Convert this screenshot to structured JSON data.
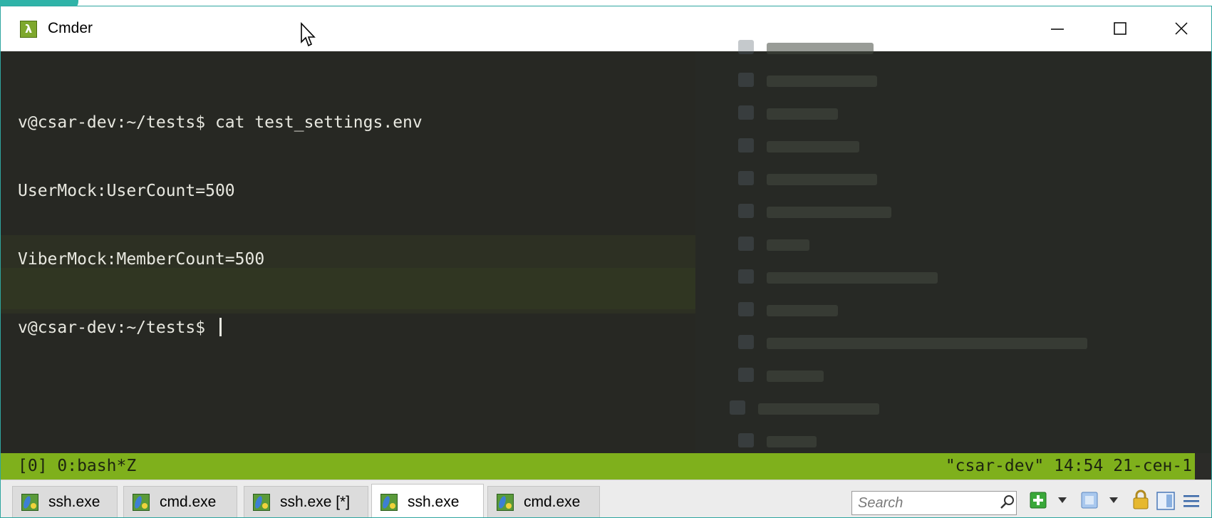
{
  "window": {
    "title": "Cmder",
    "app_icon_glyph": "λ",
    "controls": {
      "minimize_icon": "minimize-icon",
      "maximize_icon": "maximize-icon",
      "close_icon": "close-icon"
    }
  },
  "terminal": {
    "lines": [
      "v@csar-dev:~/tests$ cat test_settings.env",
      "UserMock:UserCount=500",
      "ViberMock:MemberCount=500",
      "v@csar-dev:~/tests$ "
    ]
  },
  "statusbar": {
    "left": "[0] 0:bash*Z",
    "right": "\"csar-dev\" 14:54 21-сен-1",
    "color": "#7fb01c"
  },
  "tabs": [
    {
      "label": "ssh.exe",
      "active": false
    },
    {
      "label": "cmd.exe",
      "active": false
    },
    {
      "label": "ssh.exe [*]",
      "active": false
    },
    {
      "label": "ssh.exe",
      "active": true
    },
    {
      "label": "cmd.exe",
      "active": false
    }
  ],
  "toolbar": {
    "search_placeholder": "Search",
    "icons": [
      "search-icon",
      "new-console-icon",
      "dropdown-icon",
      "switch-console-icon",
      "dropdown-icon",
      "lock-icon",
      "split-view-icon",
      "menu-icon"
    ]
  },
  "colors": {
    "terminal_bg": "#272823",
    "terminal_fg": "#e8e8e0",
    "accent_border": "#2fa6a0"
  }
}
